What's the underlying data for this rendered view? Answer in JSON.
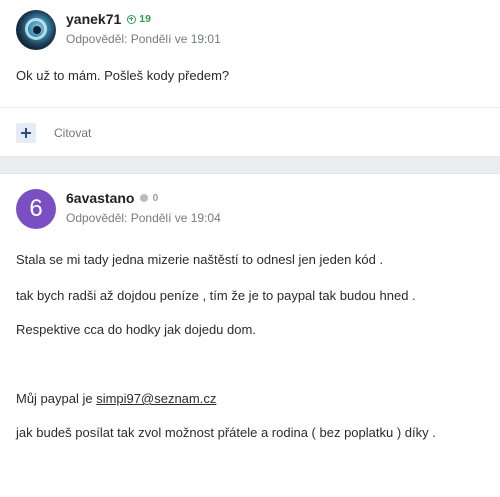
{
  "posts": [
    {
      "username": "yanek71",
      "reputation": "19",
      "reputation_icon": "plus-circle-icon",
      "time": "Odpověděl: Pondělí ve 19:01",
      "avatar_type": "photo",
      "paragraphs": [
        "Ok už to mám. Pošleš kody předem?"
      ],
      "quote_label": "Citovat"
    },
    {
      "username": "6avastano",
      "reputation": "0",
      "reputation_icon": "grey-dot-icon",
      "time": "Odpověděl: Pondělí ve 19:04",
      "avatar_letter": "6",
      "avatar_color": "#7b4fc4",
      "paragraphs": [
        "Stala se mi tady jedna mizerie naštěstí to odnesl jen jeden kód .",
        "tak bych radši až dojdou peníze , tím že je to paypal tak budou hned .",
        "Respektive cca do hodky jak dojedu dom."
      ],
      "paypal_prefix": "Můj paypal je ",
      "paypal_email": "simpi97@seznam.cz",
      "closing": "jak budeš posílat tak zvol možnost přátele a rodina ( bez  poplatku ) díky ."
    }
  ]
}
